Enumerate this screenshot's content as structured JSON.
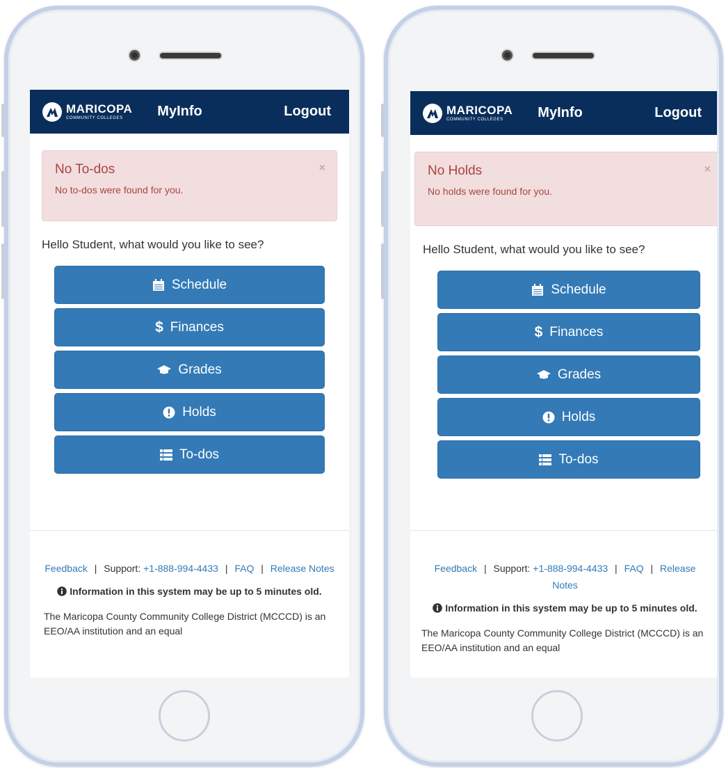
{
  "brand": {
    "name": "MARICOPA",
    "tagline": "COMMUNITY COLLEGES"
  },
  "nav": {
    "myinfo": "MyInfo",
    "logout": "Logout"
  },
  "greeting": {
    "hello": "Hello",
    "name": "Student",
    "question": ", what would you like to see?"
  },
  "buttons": {
    "schedule": "Schedule",
    "finances": "Finances",
    "grades": "Grades",
    "holds": "Holds",
    "todos": "To-dos"
  },
  "icons": {
    "schedule": "calendar-icon",
    "finances": "dollar-icon",
    "grades": "graduation-cap-icon",
    "holds": "exclamation-circle-icon",
    "todos": "list-icon"
  },
  "left_screen": {
    "alert_title": "No To-dos",
    "alert_message": "No to-dos were found for you.",
    "alert_close": "×"
  },
  "right_screen": {
    "alert_title": "No Holds",
    "alert_message": "No holds were found for you.",
    "alert_close": "×"
  },
  "footer": {
    "feedback": "Feedback",
    "sep": "|",
    "support_label": "Support:",
    "support_phone": "+1-888-994-4433",
    "faq": "FAQ",
    "release_notes": "Release Notes",
    "info": "Information in this system may be up to 5 minutes old.",
    "body": "The Maricopa County Community College District (MCCCD) is an EEO/AA institution and an equal"
  },
  "colors": {
    "navbar": "#0a2e5c",
    "button": "#337ab7",
    "alert_bg": "#f2dede",
    "alert_text": "#a94442",
    "link": "#337ab7"
  }
}
